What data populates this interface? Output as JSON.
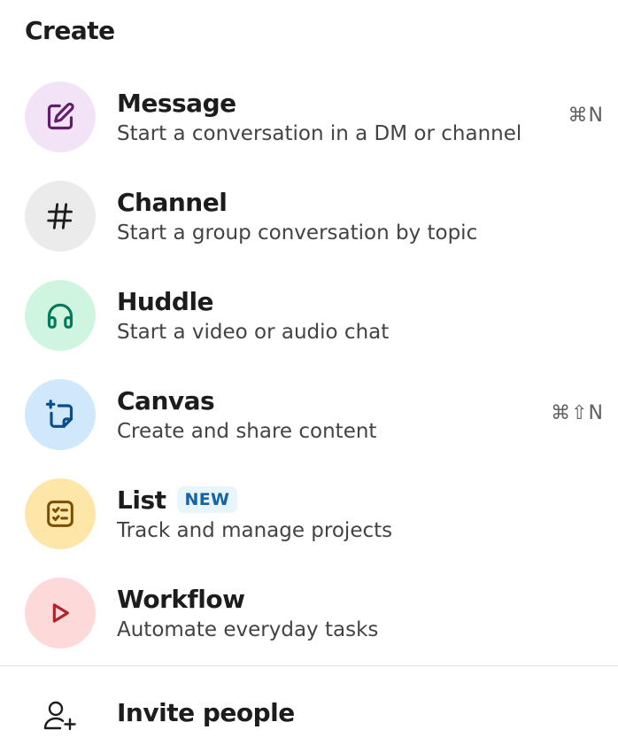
{
  "menu": {
    "title": "Create",
    "items": [
      {
        "title": "Message",
        "description": "Start a conversation in a DM or channel",
        "shortcut": "⌘N",
        "icon": "compose-icon",
        "icon_bg": "#f3e3f7",
        "icon_color": "#611f69"
      },
      {
        "title": "Channel",
        "description": "Start a group conversation by topic",
        "shortcut": "",
        "icon": "hash-icon",
        "icon_bg": "#ebebeb",
        "icon_color": "#1d1c1d"
      },
      {
        "title": "Huddle",
        "description": "Start a video or audio chat",
        "shortcut": "",
        "icon": "headphones-icon",
        "icon_bg": "#cff5e0",
        "icon_color": "#007a5a"
      },
      {
        "title": "Canvas",
        "description": "Create and share content",
        "shortcut": "⌘⇧N",
        "icon": "canvas-icon",
        "icon_bg": "#cfe8fc",
        "icon_color": "#0b4c8c"
      },
      {
        "title": "List",
        "badge": "NEW",
        "description": "Track and manage projects",
        "shortcut": "",
        "icon": "list-checklist-icon",
        "icon_bg": "#fde6a8",
        "icon_color": "#7a4e00"
      },
      {
        "title": "Workflow",
        "description": "Automate everyday tasks",
        "shortcut": "",
        "icon": "play-icon",
        "icon_bg": "#fdd9d9",
        "icon_color": "#b0232b"
      }
    ]
  },
  "footer": {
    "invite_label": "Invite people",
    "invite_icon": "add-user-icon"
  }
}
